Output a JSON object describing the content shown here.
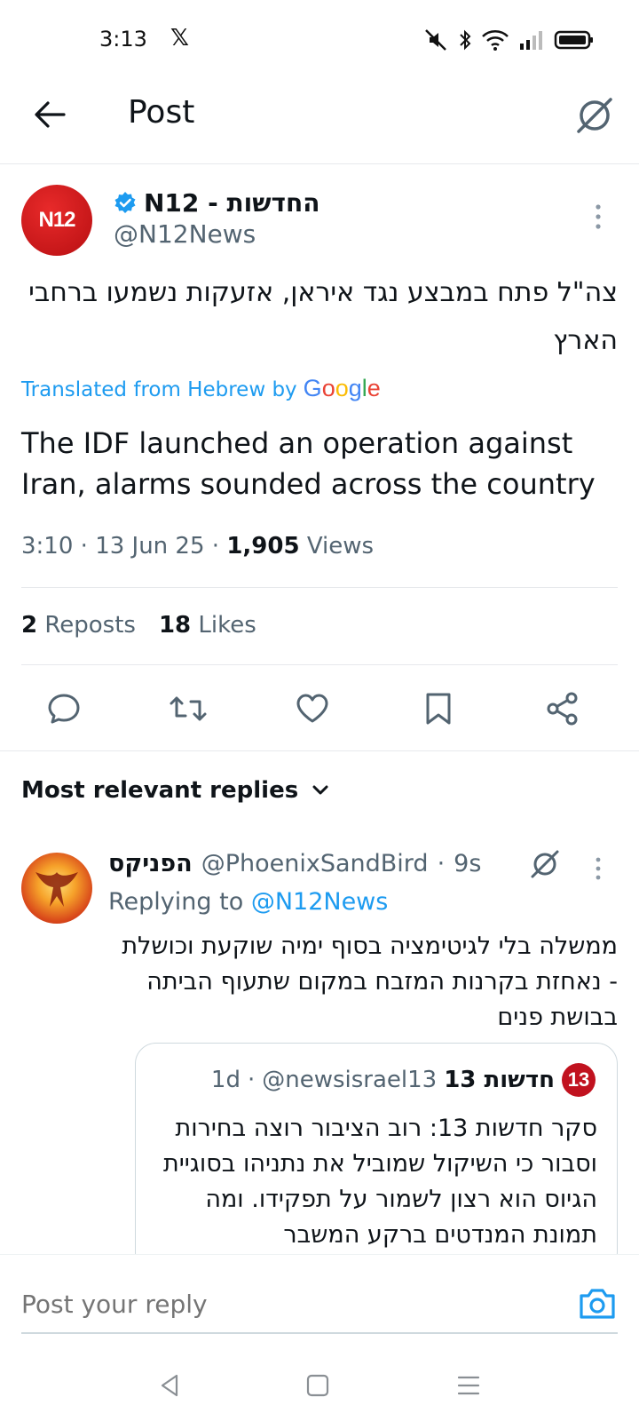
{
  "status_bar": {
    "time": "3:13",
    "app_icon": "x-logo-icon",
    "icons": [
      "mute-icon",
      "bluetooth-icon",
      "wifi-icon",
      "signal-icon",
      "battery-icon"
    ]
  },
  "header": {
    "title": "Post",
    "back_icon": "back-arrow-icon",
    "grok_icon": "grok-icon"
  },
  "post": {
    "avatar_text": "N12",
    "author_name": "החדשות - N12",
    "verified": true,
    "handle": "@N12News",
    "text_hebrew": "צה\"ל פתח במבצע נגד איראן, אזעקות נשמעו ברחבי הארץ",
    "translated_label": "Translated from Hebrew by",
    "translated_provider": "Google",
    "text_english": "The IDF launched an operation against Iran, alarms sounded across the country",
    "time": "3:10",
    "date": "13 Jun 25",
    "views_count": "1,905",
    "views_label": "Views",
    "reposts_count": "2",
    "reposts_label": "Reposts",
    "likes_count": "18",
    "likes_label": "Likes",
    "actions": [
      "reply-icon",
      "repost-icon",
      "like-icon",
      "bookmark-icon",
      "share-icon"
    ]
  },
  "replies_header": {
    "label": "Most relevant replies"
  },
  "reply": {
    "author_name": "הפניקס",
    "handle": "@PhoenixSandBird",
    "time": "9s",
    "replying_label": "Replying to",
    "replying_to": "@N12News",
    "text": "ממשלה בלי לגיטימציה בסוף ימיה שוקעת וכושלת - נאחזת בקרנות המזבח במקום שתעוף הביתה בבושת פנים",
    "quote": {
      "logo_text": "13",
      "author_name": "חדשות 13",
      "handle": "@newsisrael13",
      "time": "1d",
      "text": "סקר חדשות 13: רוב הציבור רוצה בחירות וסבור כי השיקול שמוביל את נתניהו בסוגיית הגיוס הוא רצון לשמור על תפקידו. ומה תמונת המנדטים ברקע המשבר"
    }
  },
  "composer": {
    "placeholder": "Post your reply",
    "camera_icon": "camera-icon"
  },
  "nav_bar": {
    "icons": [
      "nav-back-icon",
      "nav-home-icon",
      "nav-menu-icon"
    ]
  },
  "colors": {
    "accent": "#1d9bf0",
    "text": "#0f1419",
    "muted": "#536471",
    "divider": "#e7e9ec",
    "n12_red": "#d61b1b"
  }
}
